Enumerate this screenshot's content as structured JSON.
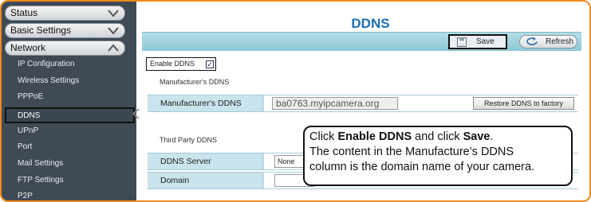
{
  "sidebar": {
    "menus": [
      {
        "label": "Status"
      },
      {
        "label": "Basic Settings"
      },
      {
        "label": "Network"
      }
    ],
    "items": [
      {
        "label": "IP Configuration"
      },
      {
        "label": "Wireless Settings"
      },
      {
        "label": "PPPoE"
      },
      {
        "label": "DDNS",
        "selected": true
      },
      {
        "label": "UPnP"
      },
      {
        "label": "Port"
      },
      {
        "label": "Mail Settings"
      },
      {
        "label": "FTP Settings"
      },
      {
        "label": "P2P"
      }
    ]
  },
  "page": {
    "title": "DDNS"
  },
  "toolbar": {
    "save_label": "Save",
    "refresh_label": "Refresh"
  },
  "form": {
    "enable_label": "Enable DDNS",
    "enable_checked": true,
    "manufacturer_section": "Manufacturer's DDNS",
    "manufacturer_row_label": "Manufacturer's DDNS",
    "manufacturer_value": "ba0763.myipcamera.org",
    "restore_label": "Restore DDNS to factory",
    "third_party_section": "Third Party DDNS",
    "server_label": "DDNS Server",
    "server_value": "None",
    "domain_label": "Domain",
    "domain_value": ""
  },
  "callout": {
    "line1_prefix": "Click ",
    "line1_bold1": "Enable DDNS",
    "line1_mid": " and click ",
    "line1_bold2": "Save",
    "line1_suffix": ".",
    "line2": "The content in the Manufacture’s DDNS",
    "line3": "column is the domain name of your camera."
  },
  "colors": {
    "frame": "#f08a1c",
    "sidebar_bg": "#3f4a55",
    "title": "#1a6fb5",
    "toolbar": "#9fd3df",
    "row_bg": "#c9e4ec"
  }
}
